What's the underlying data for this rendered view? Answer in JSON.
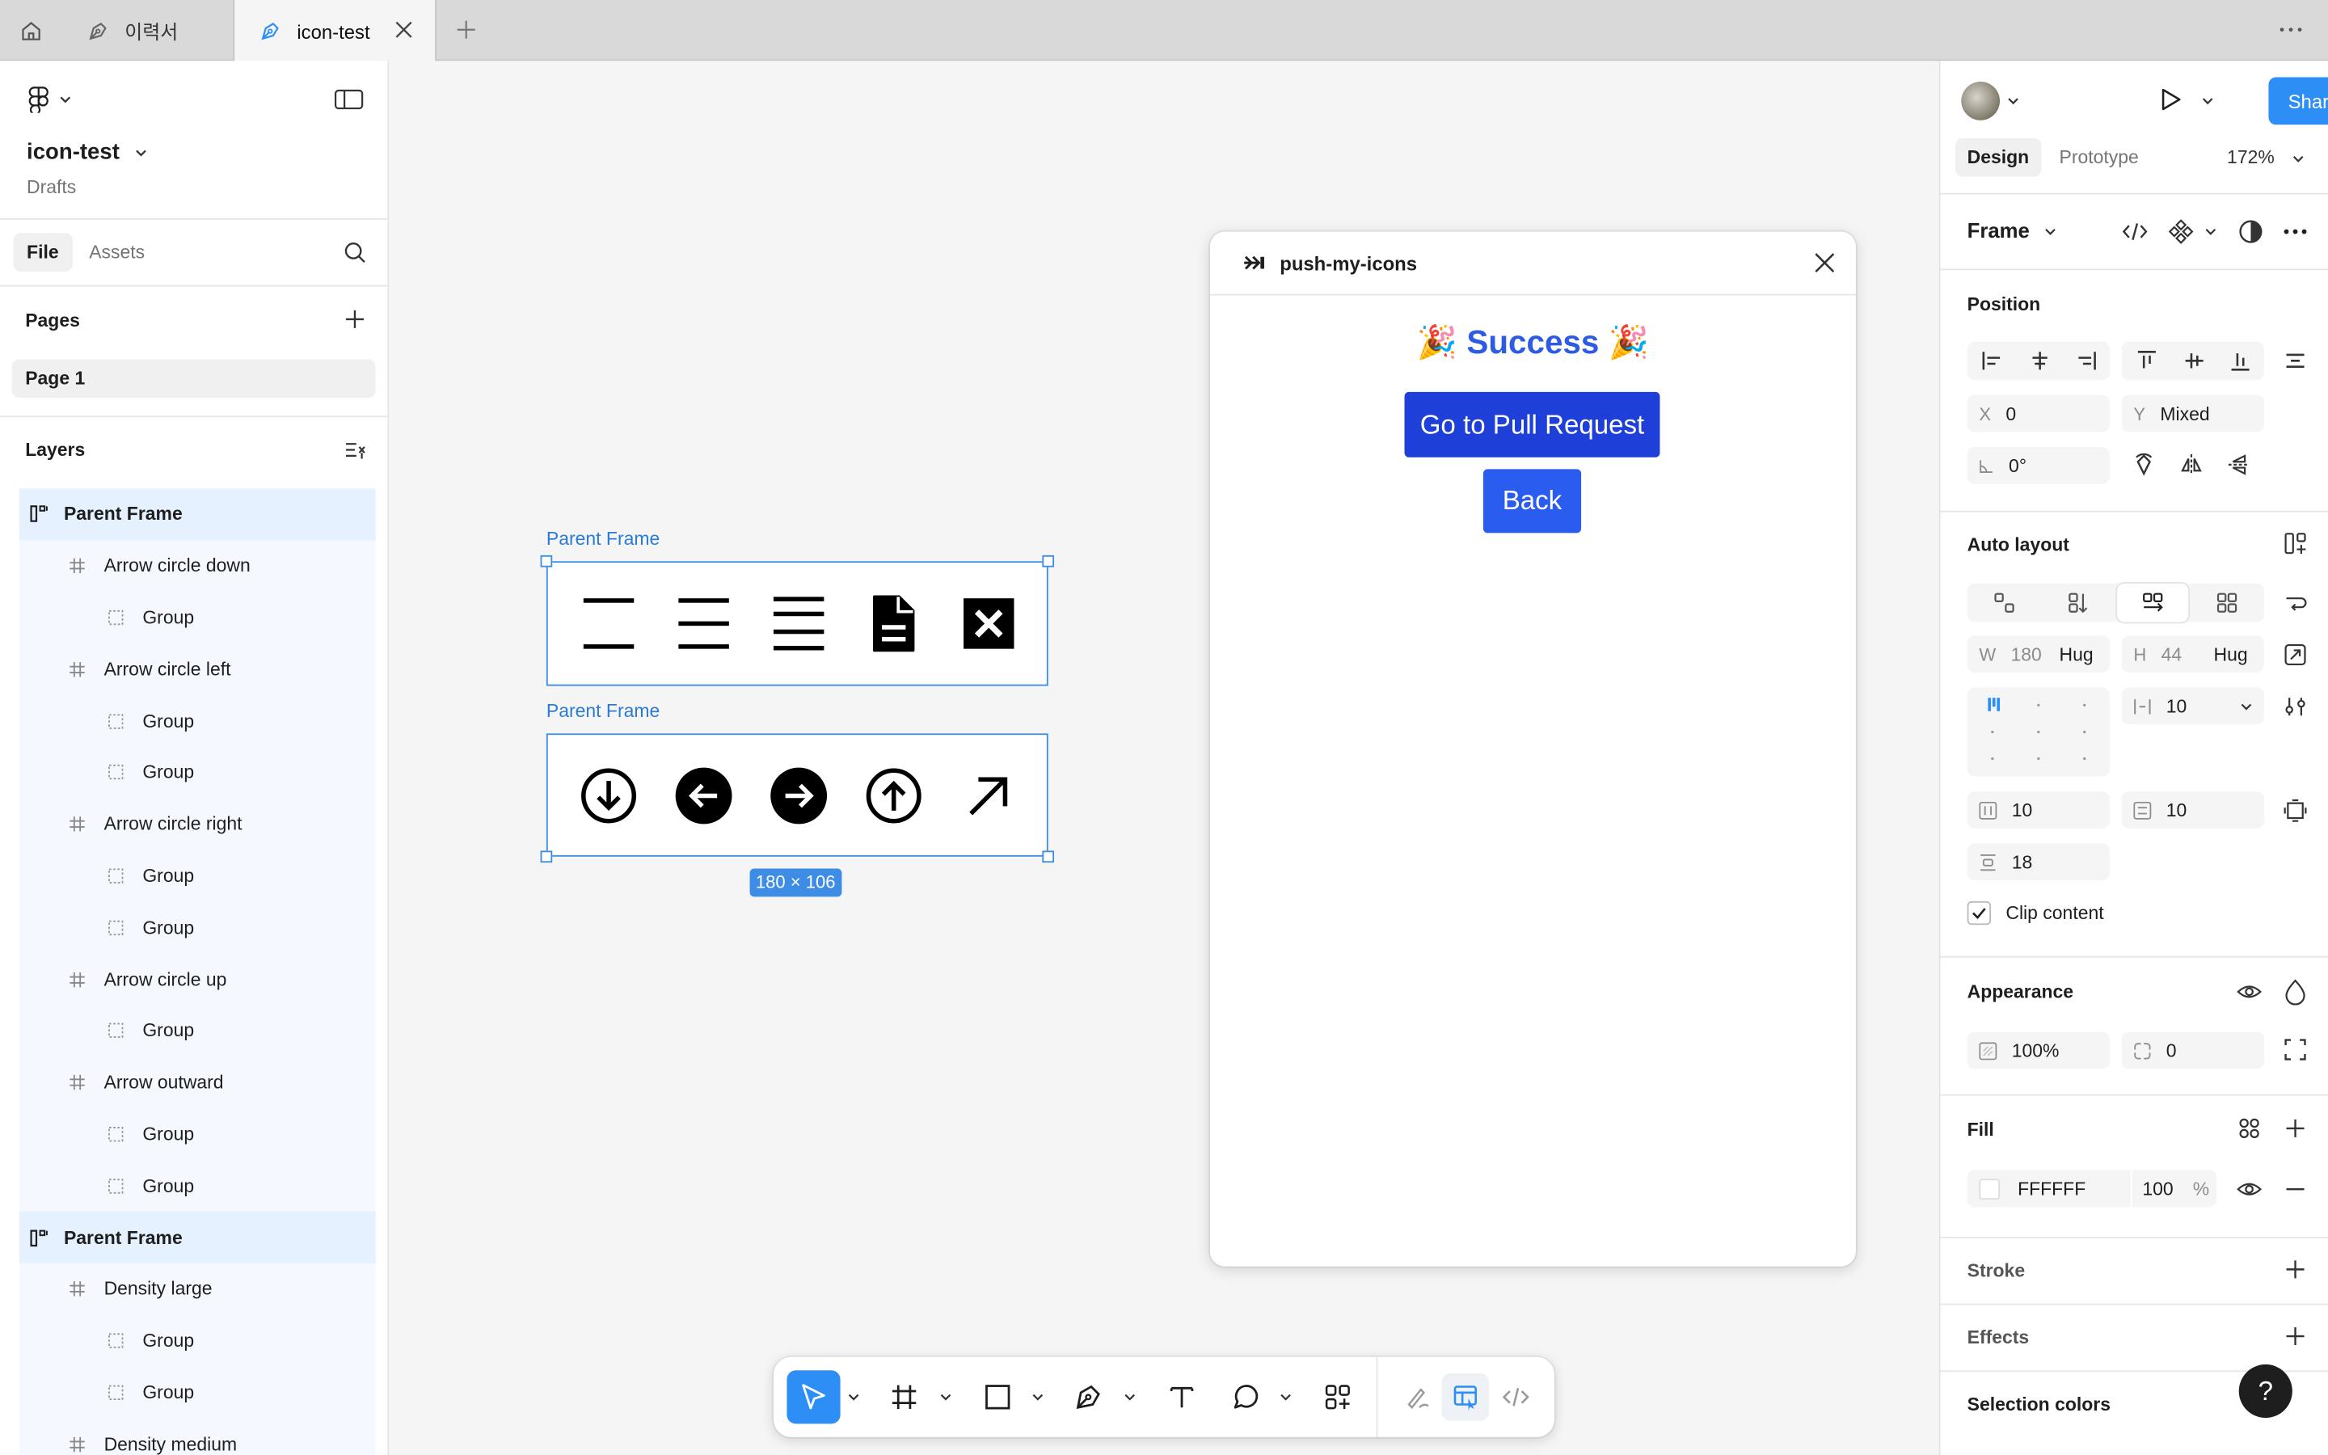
{
  "tabs": [
    {
      "label": "이력서",
      "active": false
    },
    {
      "label": "icon-test",
      "active": true
    }
  ],
  "file": {
    "name": "icon-test",
    "location": "Drafts"
  },
  "left_tabs": [
    "File",
    "Assets"
  ],
  "pages": {
    "title": "Pages",
    "items": [
      "Page 1"
    ]
  },
  "layers": {
    "title": "Layers",
    "items": [
      {
        "label": "Parent Frame",
        "level": 0,
        "type": "frame"
      },
      {
        "label": "Arrow circle down",
        "level": 1,
        "type": "component"
      },
      {
        "label": "Group",
        "level": 2,
        "type": "group"
      },
      {
        "label": "Arrow circle left",
        "level": 1,
        "type": "component"
      },
      {
        "label": "Group",
        "level": 2,
        "type": "group"
      },
      {
        "label": "Group",
        "level": 2,
        "type": "group"
      },
      {
        "label": "Arrow circle right",
        "level": 1,
        "type": "component"
      },
      {
        "label": "Group",
        "level": 2,
        "type": "group"
      },
      {
        "label": "Group",
        "level": 2,
        "type": "group"
      },
      {
        "label": "Arrow circle up",
        "level": 1,
        "type": "component"
      },
      {
        "label": "Group",
        "level": 2,
        "type": "group"
      },
      {
        "label": "Arrow outward",
        "level": 1,
        "type": "component"
      },
      {
        "label": "Group",
        "level": 2,
        "type": "group"
      },
      {
        "label": "Group",
        "level": 2,
        "type": "group"
      },
      {
        "label": "Parent Frame",
        "level": 0,
        "type": "frame"
      },
      {
        "label": "Density large",
        "level": 1,
        "type": "component"
      },
      {
        "label": "Group",
        "level": 2,
        "type": "group"
      },
      {
        "label": "Group",
        "level": 2,
        "type": "group"
      },
      {
        "label": "Density medium",
        "level": 1,
        "type": "component"
      }
    ]
  },
  "canvas": {
    "frame1_label": "Parent Frame",
    "frame2_label": "Parent Frame",
    "size_badge": "180 × 106"
  },
  "plugin": {
    "title": "push-my-icons",
    "success": "🎉 Success 🎉",
    "pr_button": "Go to Pull Request",
    "back_button": "Back"
  },
  "right": {
    "share": "Share",
    "tabs": [
      "Design",
      "Prototype"
    ],
    "zoom": "172%",
    "frame_title": "Frame",
    "position": {
      "title": "Position",
      "x_label": "X",
      "x": "0",
      "y_label": "Y",
      "y": "Mixed",
      "rotation": "0°"
    },
    "auto_layout": {
      "title": "Auto layout",
      "w_label": "W",
      "w": "180",
      "w_mode": "Hug",
      "h_label": "H",
      "h": "44",
      "h_mode": "Hug",
      "gap": "10",
      "padding_h": "10",
      "padding_v": "10",
      "spacing": "18",
      "clip": "Clip content"
    },
    "appearance": {
      "title": "Appearance",
      "opacity": "100%",
      "radius": "0"
    },
    "fill": {
      "title": "Fill",
      "hex": "FFFFFF",
      "opacity": "100",
      "unit": "%"
    },
    "stroke": "Stroke",
    "effects": "Effects",
    "selection_colors": "Selection colors",
    "help": "?"
  },
  "colors": {
    "accent": "#2d8ef5",
    "selection": "#3d8de6",
    "plugin_button": "#1e40d8"
  }
}
